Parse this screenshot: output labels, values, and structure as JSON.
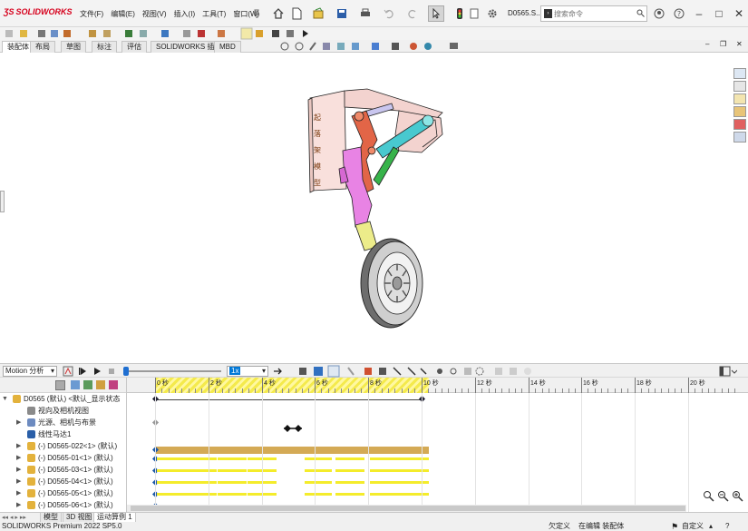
{
  "app": {
    "logo_text": "SOLIDWORKS",
    "document_name": "D0565.S...",
    "menus": [
      "文件(F)",
      "编辑(E)",
      "视图(V)",
      "插入(I)",
      "工具(T)",
      "窗口(W)"
    ],
    "search_placeholder": "搜索命令"
  },
  "command_tabs": [
    "装配体",
    "布局",
    "草图",
    "标注",
    "评估",
    "SOLIDWORKS 插件",
    "MBD"
  ],
  "model": {
    "bracket_lettering": "起落架模型"
  },
  "motion": {
    "study_type": "Motion 分析",
    "playback_speed": "1x"
  },
  "tree": {
    "items": [
      {
        "label": "D0565 (默认) <默认_显示状态",
        "level": 0,
        "expander": "▼"
      },
      {
        "label": "视向及相机视图",
        "level": 1,
        "expander": ""
      },
      {
        "label": "光源、相机与布景",
        "level": 1,
        "expander": "▶"
      },
      {
        "label": "线性马达1",
        "level": 1,
        "expander": ""
      },
      {
        "label": "(-) D0565-022<1> (默认)",
        "level": 1,
        "expander": "▶"
      },
      {
        "label": "(-) D0565-01<1> (默认)",
        "level": 1,
        "expander": "▶"
      },
      {
        "label": "(-) D0565-03<1> (默认)",
        "level": 1,
        "expander": "▶"
      },
      {
        "label": "(-) D0565-04<1> (默认)",
        "level": 1,
        "expander": "▶"
      },
      {
        "label": "(-) D0565-05<1> (默认)",
        "level": 1,
        "expander": "▶"
      },
      {
        "label": "(-) D0565-06<1> (默认)",
        "level": 1,
        "expander": "▶"
      }
    ]
  },
  "timeline": {
    "tick_labels": [
      "0 秒",
      "2 秒",
      "4 秒",
      "6 秒",
      "8 秒",
      "10 秒",
      "12 秒",
      "14 秒",
      "16 秒",
      "18 秒",
      "20 秒"
    ],
    "highlight_end_seconds": 10
  },
  "bottom_tabs": [
    "模型",
    "3D 视图",
    "运动算例 1"
  ],
  "status": {
    "product": "SOLIDWORKS Premium 2022 SP5.0",
    "definition": "欠定义",
    "mode": "在编辑 装配体",
    "custom": "自定义"
  }
}
